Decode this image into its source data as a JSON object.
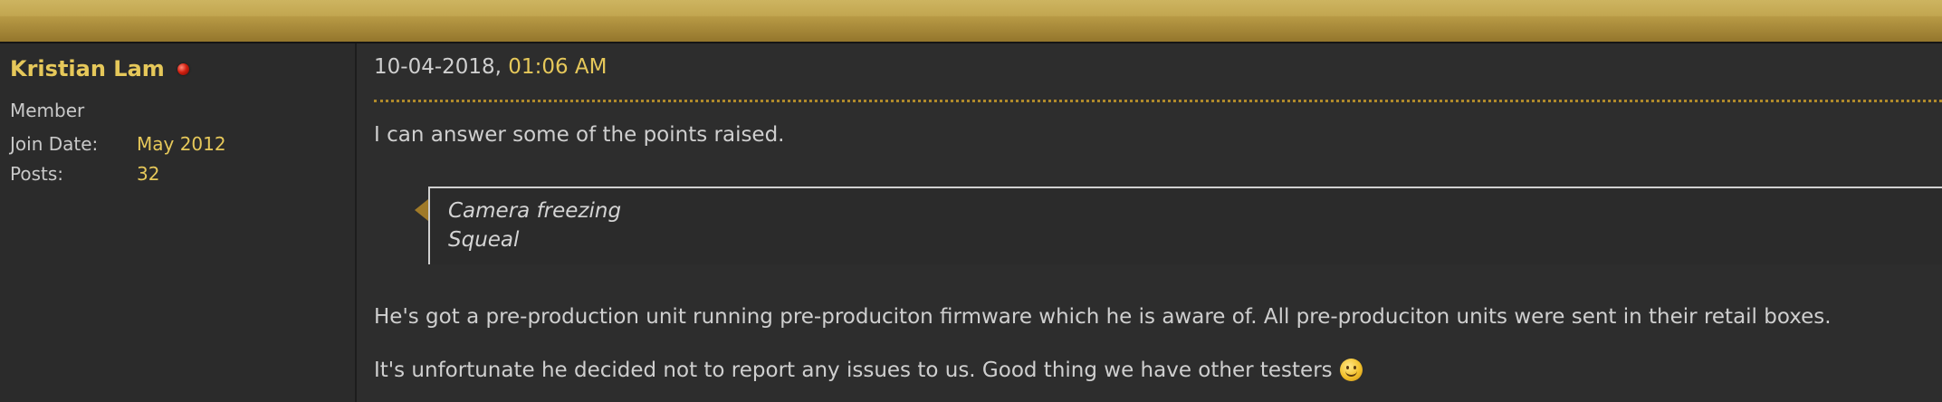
{
  "user": {
    "name": "Kristian Lam",
    "title": "Member",
    "stats": [
      {
        "label": "Join Date:",
        "value": "May 2012"
      },
      {
        "label": "Posts:",
        "value": "32"
      }
    ]
  },
  "post": {
    "date": "10-04-2018, ",
    "time": "01:06 AM",
    "intro": "I can answer some of the points raised.",
    "quote_lines": [
      "Camera freezing",
      "Squeal"
    ],
    "paragraph1": "He's got a pre-production unit running pre-produciton firmware which he is aware of. All pre-produciton units were sent in their retail boxes.",
    "paragraph2": "It's unfortunate he decided not to report any issues to us. Good thing we have other testers"
  },
  "icons": {
    "status": "offline-status-icon",
    "quote_marker": "quote-arrow-icon",
    "emoticon": "smile-icon"
  },
  "colors": {
    "accent": "#e6c85a",
    "header_bar": "#c2a650",
    "divider": "#b08a2a",
    "text": "#cfcfcf",
    "background": "#2d2d2d"
  }
}
